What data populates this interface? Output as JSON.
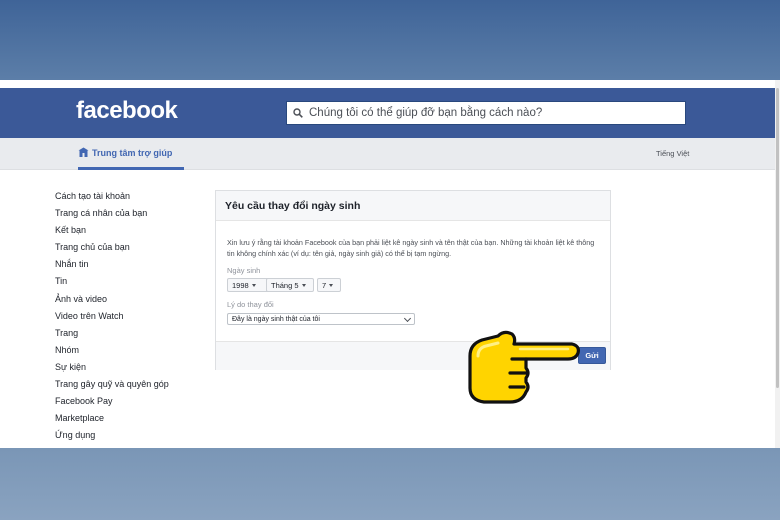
{
  "header": {
    "logo_text": "facebook",
    "search_placeholder": "Chúng tôi có thể giúp đỡ bạn bằng cách nào?"
  },
  "subnav": {
    "help_center_label": "Trung tâm trợ giúp",
    "language": "Tiếng Việt"
  },
  "sidebar": {
    "items": [
      {
        "label": "Cách tạo tài khoản"
      },
      {
        "label": "Trang cá nhân của bạn"
      },
      {
        "label": "Kết bạn"
      },
      {
        "label": "Trang chủ của bạn"
      },
      {
        "label": "Nhắn tin"
      },
      {
        "label": "Tin"
      },
      {
        "label": "Ảnh và video"
      },
      {
        "label": "Video trên Watch"
      },
      {
        "label": "Trang"
      },
      {
        "label": "Nhóm"
      },
      {
        "label": "Sự kiện"
      },
      {
        "label": "Trang gây quỹ và quyên góp"
      },
      {
        "label": "Facebook Pay"
      },
      {
        "label": "Marketplace"
      },
      {
        "label": "Ứng dụng"
      }
    ]
  },
  "form": {
    "title": "Yêu cầu thay đổi ngày sinh",
    "notice": "Xin lưu ý rằng tài khoản Facebook của bạn phải liệt kê ngày sinh và tên thật của bạn. Những tài khoản liệt kê thông tin không chính xác (ví dụ: tên giả, ngày sinh giả) có thể bị tạm ngừng.",
    "birthday_label": "Ngày sinh",
    "year": "1998",
    "month": "Tháng 5",
    "day": "7",
    "reason_label": "Lý do thay đổi",
    "reason_value": "Đây là ngày sinh thật của tôi",
    "submit_label": "Gửi"
  },
  "colors": {
    "brand": "#3b5998",
    "button": "#4267b2",
    "pointer_hand": "#ffd700"
  }
}
